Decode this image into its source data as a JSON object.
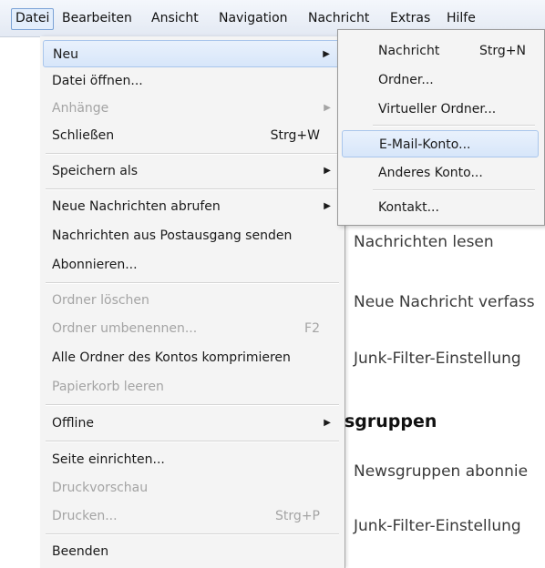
{
  "menubar": {
    "items": [
      "Datei",
      "Bearbeiten",
      "Ansicht",
      "Navigation",
      "Nachricht",
      "Extras",
      "Hilfe"
    ]
  },
  "file_menu": {
    "items": [
      {
        "label": "Neu",
        "shortcut": "",
        "submenu": true,
        "disabled": false,
        "highlight": true
      },
      {
        "label": "Datei öffnen...",
        "shortcut": "",
        "submenu": false,
        "disabled": false
      },
      {
        "label": "Anhänge",
        "shortcut": "",
        "submenu": true,
        "disabled": true
      },
      {
        "label": "Schließen",
        "shortcut": "Strg+W",
        "submenu": false,
        "disabled": false
      },
      {
        "label": "Speichern als",
        "shortcut": "",
        "submenu": true,
        "disabled": false
      },
      {
        "label": "Neue Nachrichten abrufen",
        "shortcut": "",
        "submenu": true,
        "disabled": false
      },
      {
        "label": "Nachrichten aus Postausgang senden",
        "shortcut": "",
        "submenu": false,
        "disabled": false
      },
      {
        "label": "Abonnieren...",
        "shortcut": "",
        "submenu": false,
        "disabled": false
      },
      {
        "label": "Ordner löschen",
        "shortcut": "",
        "submenu": false,
        "disabled": true
      },
      {
        "label": "Ordner umbenennen...",
        "shortcut": "F2",
        "submenu": false,
        "disabled": true
      },
      {
        "label": "Alle Ordner des Kontos komprimieren",
        "shortcut": "",
        "submenu": false,
        "disabled": false
      },
      {
        "label": "Papierkorb leeren",
        "shortcut": "",
        "submenu": false,
        "disabled": true
      },
      {
        "label": "Offline",
        "shortcut": "",
        "submenu": true,
        "disabled": false
      },
      {
        "label": "Seite einrichten...",
        "shortcut": "",
        "submenu": false,
        "disabled": false
      },
      {
        "label": "Druckvorschau",
        "shortcut": "",
        "submenu": false,
        "disabled": true
      },
      {
        "label": "Drucken...",
        "shortcut": "Strg+P",
        "submenu": false,
        "disabled": true
      },
      {
        "label": "Beenden",
        "shortcut": "",
        "submenu": false,
        "disabled": false
      }
    ]
  },
  "new_submenu": {
    "items": [
      {
        "label": "Nachricht",
        "shortcut": "Strg+N"
      },
      {
        "label": "Ordner...",
        "shortcut": ""
      },
      {
        "label": "Virtueller Ordner...",
        "shortcut": ""
      },
      {
        "label": "E-Mail-Konto...",
        "shortcut": "",
        "highlight": true
      },
      {
        "label": "Anderes Konto...",
        "shortcut": ""
      },
      {
        "label": "Kontakt...",
        "shortcut": ""
      }
    ]
  },
  "background": {
    "links": [
      "Nachrichten lesen",
      "Neue Nachricht verfass",
      "Junk-Filter-Einstellung",
      "Newsgruppen abonnie",
      "Junk-Filter-Einstellung"
    ],
    "section_heading": "sgruppen"
  },
  "icons": {
    "submenu_arrow": "▶"
  },
  "colors": {
    "menu_bg": "#f4f4f4",
    "highlight_border": "#a9c6ec",
    "disabled_text": "#a4a4a4"
  }
}
